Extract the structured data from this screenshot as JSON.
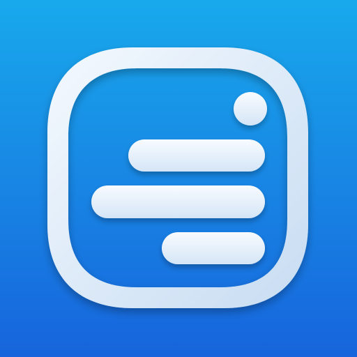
{
  "icon": {
    "symbol": "text-lines-with-dot-icon",
    "colors": {
      "background_top": "#18a9ec",
      "background_bottom": "#1764dc",
      "frame_light": "#f4f9fe",
      "frame_shade": "#c7dcf2",
      "bar_light": "#f7fbff",
      "bar_shade": "#d5e5f6"
    }
  }
}
